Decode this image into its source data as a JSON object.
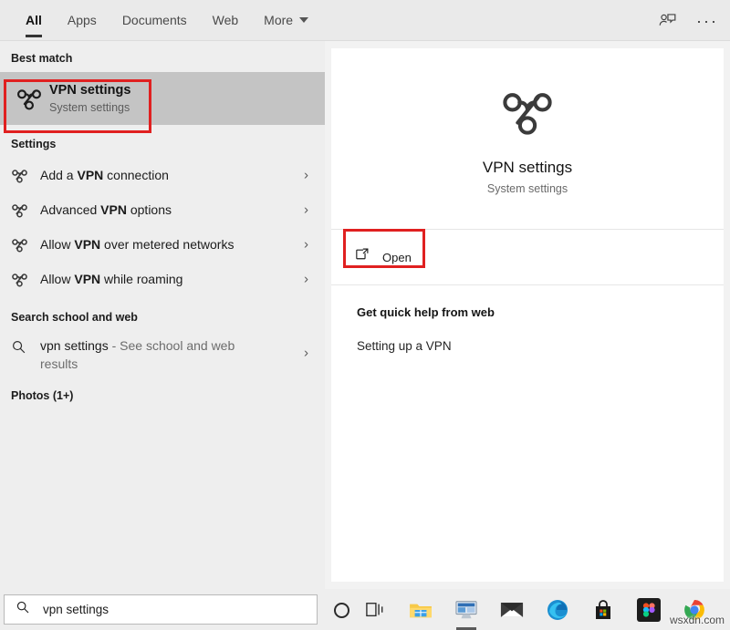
{
  "topbar": {
    "tabs": [
      {
        "label": "All",
        "active": true
      },
      {
        "label": "Apps",
        "active": false
      },
      {
        "label": "Documents",
        "active": false
      },
      {
        "label": "Web",
        "active": false
      },
      {
        "label": "More",
        "active": false,
        "has_caret": true
      }
    ],
    "feedback_icon": "person-chat-icon",
    "overflow_label": "···"
  },
  "left": {
    "best_match_heading": "Best match",
    "best_match": {
      "title": "VPN settings",
      "subtitle": "System settings",
      "icon": "vpn-icon"
    },
    "settings_heading": "Settings",
    "settings_items": [
      {
        "prefix": "Add a ",
        "bold": "VPN",
        "suffix": " connection"
      },
      {
        "prefix": "Advanced ",
        "bold": "VPN",
        "suffix": " options"
      },
      {
        "prefix": "Allow ",
        "bold": "VPN",
        "suffix": " over metered networks"
      },
      {
        "prefix": "Allow ",
        "bold": "VPN",
        "suffix": " while roaming"
      }
    ],
    "web_heading": "Search school and web",
    "web_item": {
      "query": "vpn settings",
      "suffix": " - See school and web results"
    },
    "photos_heading": "Photos (1+)"
  },
  "right": {
    "hero_title": "VPN settings",
    "hero_subtitle": "System settings",
    "open_label": "Open",
    "open_icon": "external-link-icon",
    "help_heading": "Get quick help from web",
    "help_link": "Setting up a VPN"
  },
  "taskbar": {
    "search_value": "vpn settings",
    "search_icon": "search-icon",
    "cortana_icon": "cortana-ring-icon",
    "apps": [
      {
        "name": "task-view-icon"
      },
      {
        "name": "file-explorer-icon"
      },
      {
        "name": "remote-desktop-icon"
      },
      {
        "name": "mail-icon"
      },
      {
        "name": "edge-icon"
      },
      {
        "name": "microsoft-store-icon"
      },
      {
        "name": "figma-icon"
      },
      {
        "name": "chrome-icon"
      }
    ]
  },
  "watermark": "wsxdn.com",
  "colors": {
    "accent_red": "#e02020",
    "panel_bg": "#eeeeee",
    "selection_bg": "#c4c4c4",
    "card_bg": "#ffffff"
  }
}
